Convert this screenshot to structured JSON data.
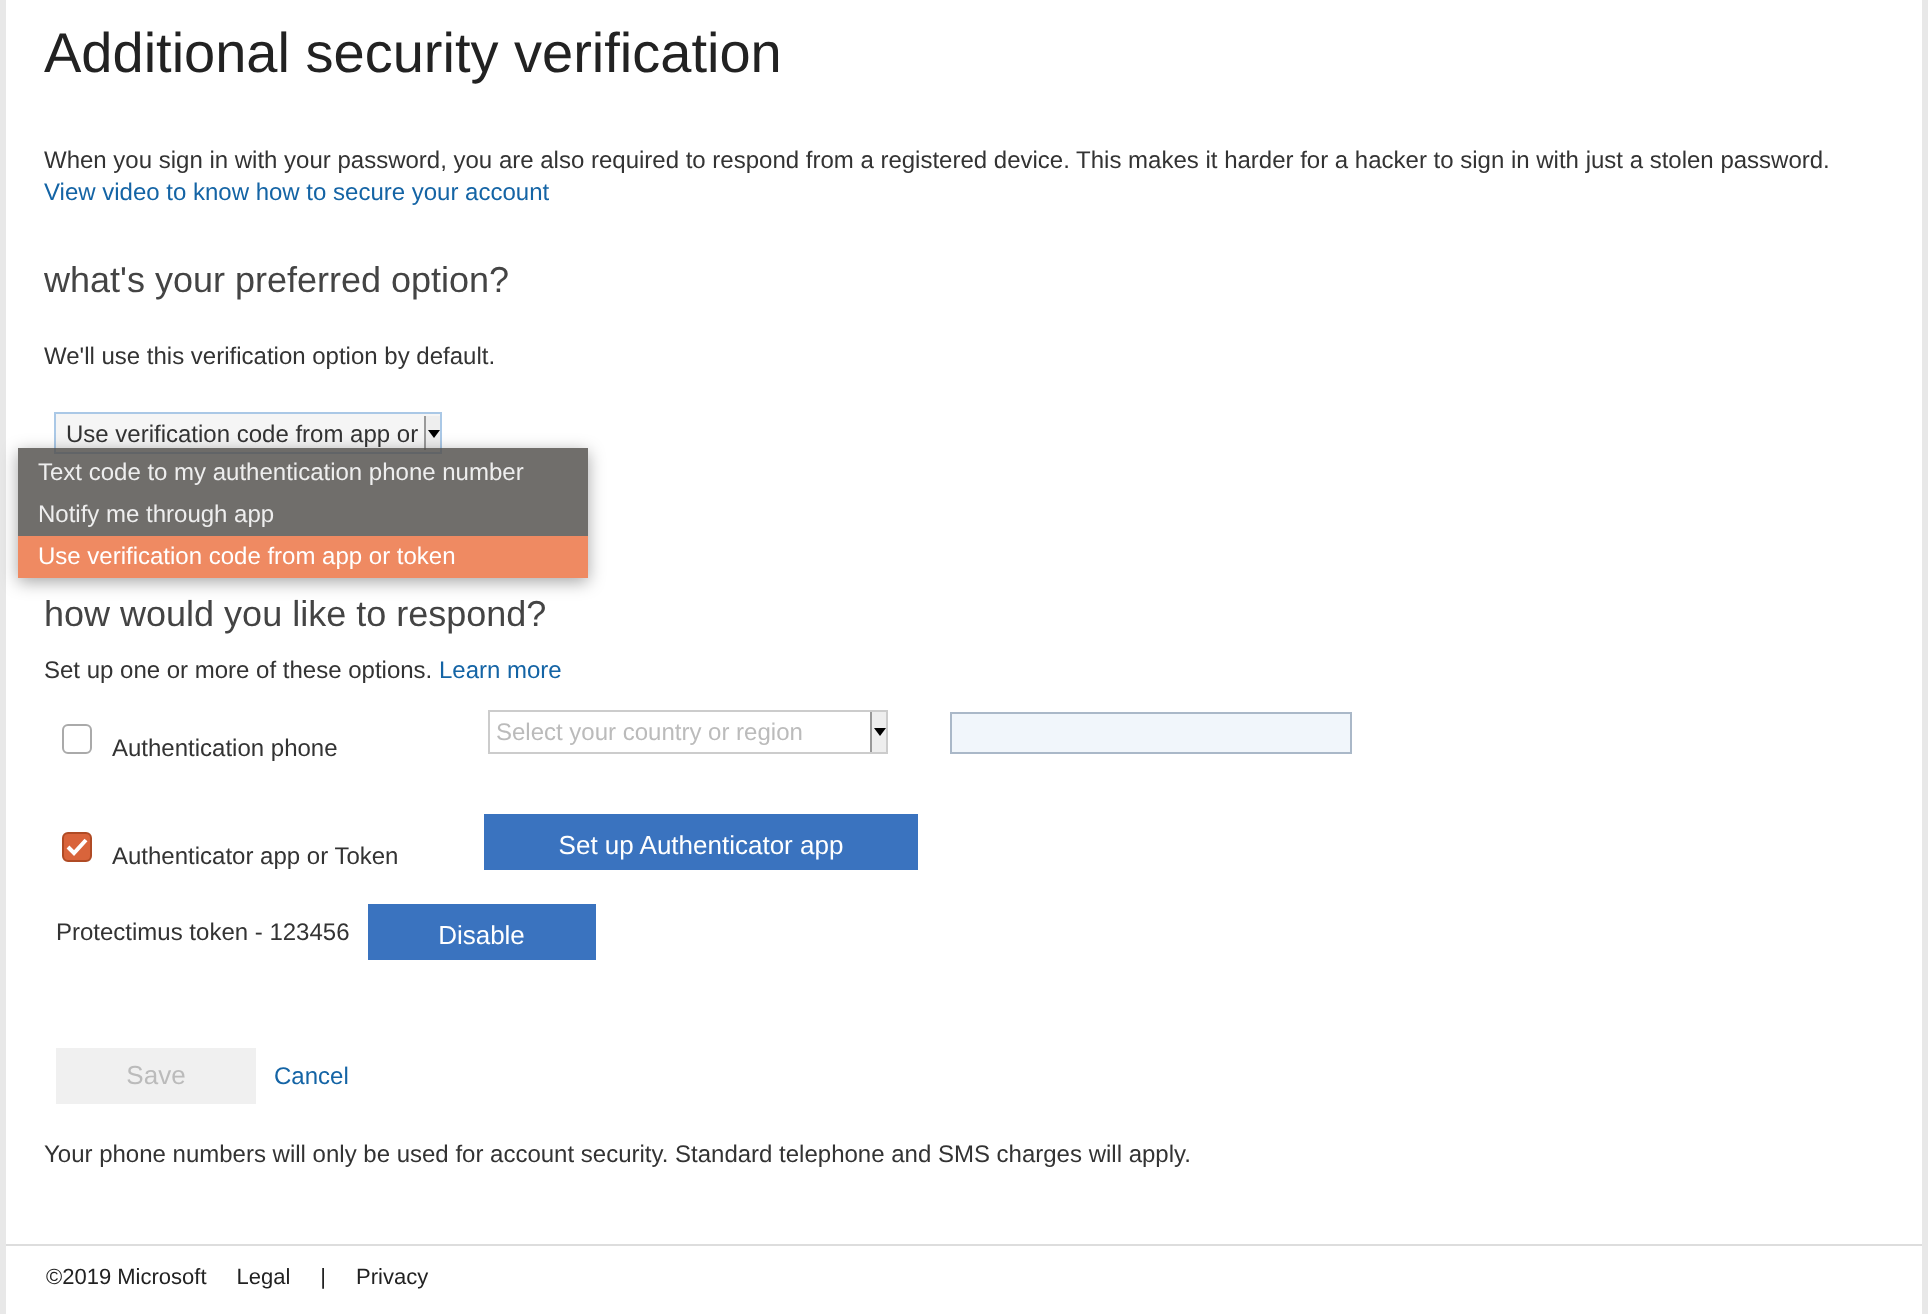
{
  "title": "Additional security verification",
  "intro": {
    "text": "When you sign in with your password, you are also required to respond from a registered device. This makes it harder for a hacker to sign in with just a stolen password.",
    "link": "View video to know how to secure your account"
  },
  "preferred": {
    "heading": "what's your preferred option?",
    "description": "We'll use this verification option by default.",
    "select": {
      "value": "Use verification code from app or",
      "expanded": true
    },
    "options": [
      {
        "label": "Text code to my authentication phone number",
        "selected": false
      },
      {
        "label": "Notify me through app",
        "selected": false
      },
      {
        "label": "Use verification code from app or token",
        "selected": true
      }
    ]
  },
  "respond": {
    "heading": "how would you like to respond?",
    "description": "Set up one or more of these options.",
    "link": "Learn more"
  },
  "methods": [
    {
      "kind": "phone",
      "label": "Authentication phone",
      "checked": false,
      "country": {
        "placeholder": "Select your country or region"
      }
    },
    {
      "kind": "app",
      "label": "Authenticator app or Token",
      "checked": true,
      "button": "Set up Authenticator app"
    }
  ],
  "token": {
    "label": "Protectimus token - 123456",
    "button": "Disable"
  },
  "actions": {
    "save": {
      "label": "Save",
      "disabled": true
    },
    "cancel": "Cancel"
  },
  "note": "Your phone numbers will only be used for account security. Standard telephone and SMS charges will apply.",
  "footer": {
    "copyright": "©2019 Microsoft",
    "links": [
      "Legal",
      "Privacy"
    ],
    "separator": "|"
  }
}
